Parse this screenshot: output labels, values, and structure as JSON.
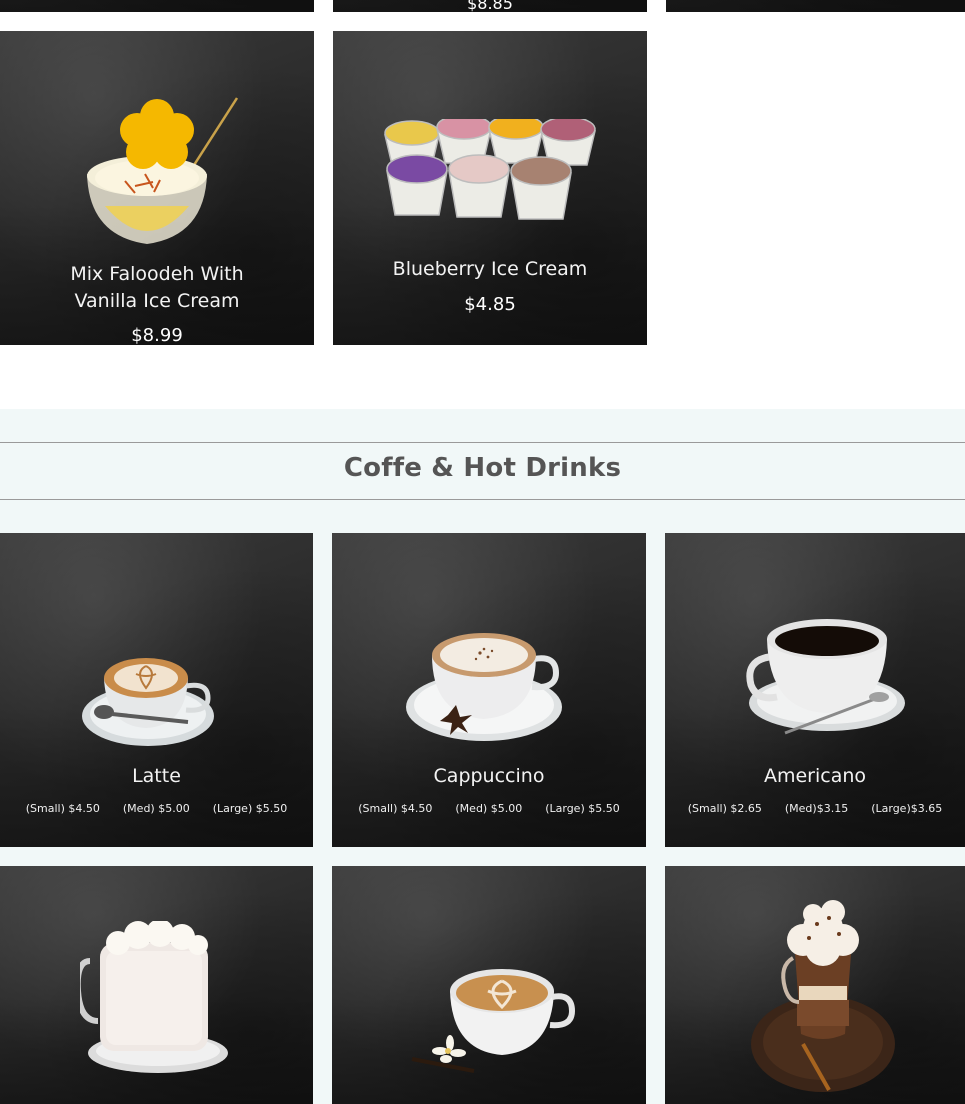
{
  "top_row": {
    "partial_price": "$8.85"
  },
  "dessert_items": [
    {
      "name_line1": "Mix Faloodeh With",
      "name_line2": "Vanilla Ice Cream",
      "price": "$8.99"
    },
    {
      "name": "Blueberry Ice Cream",
      "price": "$4.85"
    }
  ],
  "section": {
    "title": "Coffe & Hot Drinks"
  },
  "drinks": [
    {
      "name": "Latte",
      "sizes": [
        "(Small) $4.50",
        "(Med) $5.00",
        "(Large) $5.50"
      ]
    },
    {
      "name": "Cappuccino",
      "sizes": [
        "(Small) $4.50",
        "(Med) $5.00",
        "(Large) $5.50"
      ]
    },
    {
      "name": "Americano",
      "sizes": [
        "(Small) $2.65",
        "(Med)$3.15",
        "(Large)$3.65"
      ]
    }
  ]
}
